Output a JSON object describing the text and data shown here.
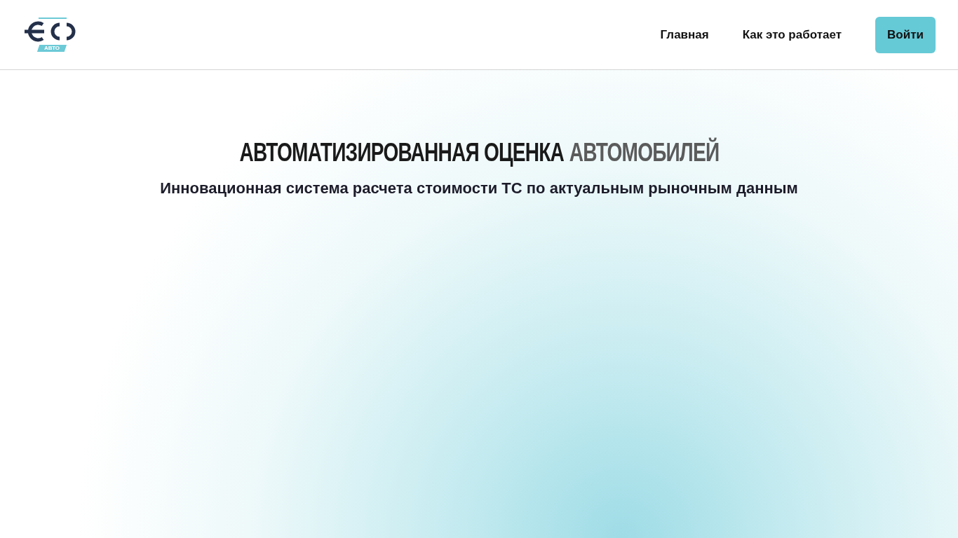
{
  "header": {
    "logo": {
      "badge": "АВТО"
    },
    "nav": [
      {
        "label": "Главная"
      },
      {
        "label": "Как это работает"
      }
    ],
    "login_button": "Войти"
  },
  "hero": {
    "title": "АВТОМАТИЗИРОВАННАЯ ОЦЕНКА",
    "title_accent": "АВТОМОБИЛЕЙ",
    "subtitle": "Инновационная система расчета стоимости ТС по актуальным рыночным данным"
  }
}
